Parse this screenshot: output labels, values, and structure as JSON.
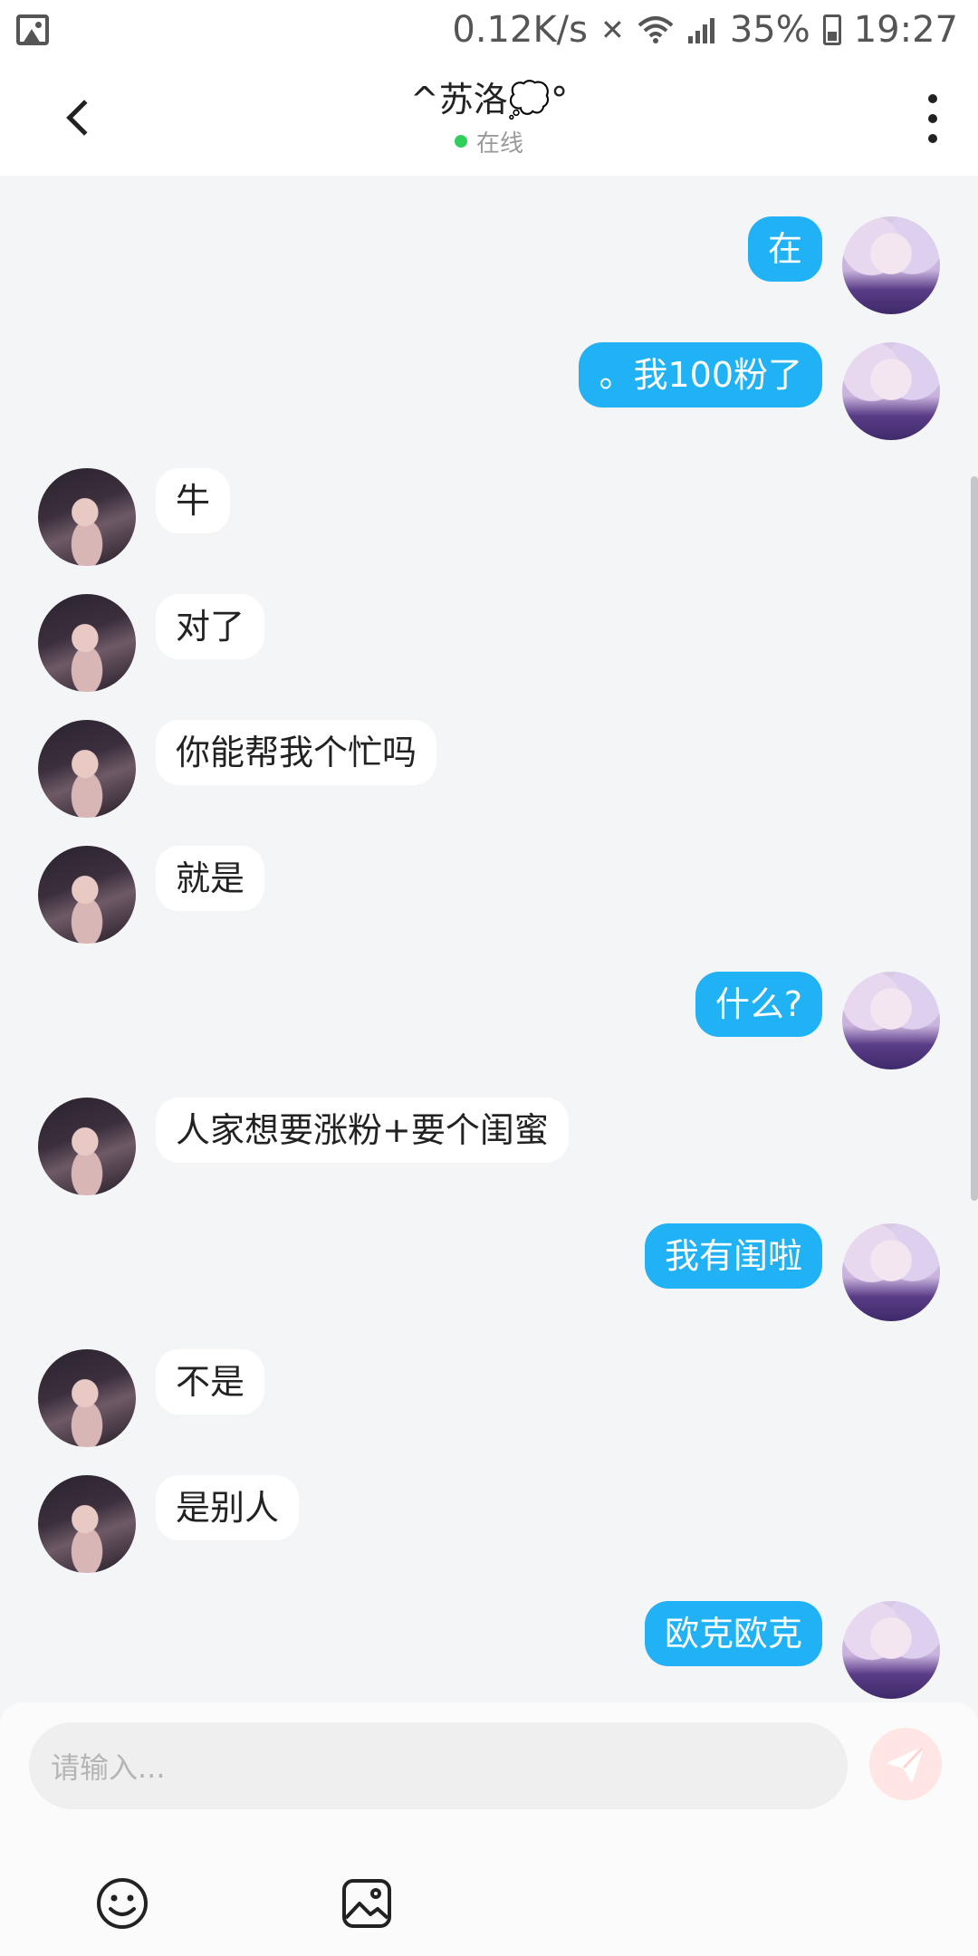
{
  "status_bar": {
    "speed": "0.12K/s",
    "battery": "35%",
    "time": "19:27"
  },
  "header": {
    "title": "^苏洛💭°",
    "presence": "在线"
  },
  "messages": [
    {
      "side": "out",
      "text": "在"
    },
    {
      "side": "out",
      "text": "。我100粉了"
    },
    {
      "side": "in",
      "text": "牛"
    },
    {
      "side": "in",
      "text": "对了"
    },
    {
      "side": "in",
      "text": "你能帮我个忙吗"
    },
    {
      "side": "in",
      "text": "就是"
    },
    {
      "side": "out",
      "text": "什么?"
    },
    {
      "side": "in",
      "text": "人家想要涨粉+要个闺蜜"
    },
    {
      "side": "out",
      "text": "我有闺啦"
    },
    {
      "side": "in",
      "text": "不是"
    },
    {
      "side": "in",
      "text": "是别人"
    },
    {
      "side": "out",
      "text": "欧克欧克"
    }
  ],
  "composer": {
    "placeholder": "请输入..."
  },
  "colors": {
    "outgoing_bubble": "#21b2f5",
    "incoming_bubble": "#ffffff",
    "online_dot": "#2fd05a",
    "send_button": "#ffe6e4"
  },
  "icons": {
    "back": "chevron-left-icon",
    "more": "more-vertical-icon",
    "send": "send-icon",
    "emoji": "emoji-icon",
    "image": "image-icon"
  }
}
